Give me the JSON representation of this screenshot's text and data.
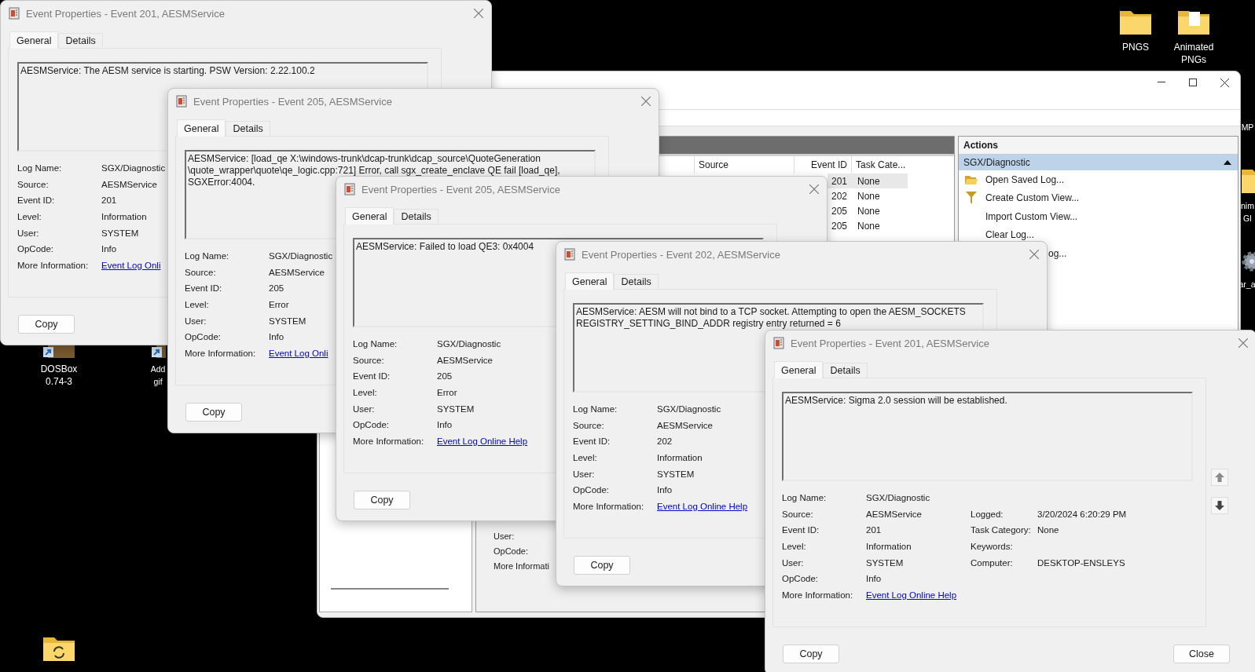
{
  "desktop_icons": [
    {
      "label": "PNGS",
      "kind": "folder"
    },
    {
      "label": "Animated\nPNGs",
      "kind": "docfolder"
    },
    {
      "label": "MP",
      "kind": "none"
    },
    {
      "label": "nim\nGI",
      "kind": "folder"
    },
    {
      "label": "ar_a",
      "kind": "gear"
    },
    {
      "label": "DOSBox\n0.74-3",
      "kind": "app"
    },
    {
      "label": "Add\ngif",
      "kind": "app"
    },
    {
      "kind": "syncfolder"
    }
  ],
  "main_window": {
    "table": {
      "columns": [
        "Source",
        "Event ID",
        "Task Cate..."
      ],
      "rows": [
        {
          "event_id": "201",
          "task_category": "None",
          "selected": true
        },
        {
          "event_id": "202",
          "task_category": "None",
          "selected": false
        },
        {
          "event_id": "205",
          "task_category": "None",
          "selected": false
        },
        {
          "event_id": "205",
          "task_category": "None",
          "selected": false
        }
      ]
    },
    "detail_labels": [
      "User:",
      "OpCode:",
      "More Informati"
    ],
    "actions": {
      "title": "Actions",
      "group": {
        "label": "SGX/Diagnostic",
        "expanded": true
      },
      "items": [
        {
          "label": "Open Saved Log...",
          "kind": "open"
        },
        {
          "label": "Create Custom View...",
          "kind": "filter"
        },
        {
          "label": "Import Custom View...",
          "kind": "plain"
        },
        {
          "label": "Clear Log...",
          "kind": "plain"
        },
        {
          "label": "og...",
          "kind": "cut"
        }
      ]
    }
  },
  "dialogs": [
    {
      "title": "Event Properties - Event 201, AESMService",
      "tabs": [
        {
          "label": "General",
          "selected": true
        },
        {
          "label": "Details",
          "selected": false
        }
      ],
      "message": "AESMService: The AESM service is starting. PSW Version: 2.22.100.2",
      "fields": [
        {
          "label": "Log Name:",
          "value": "SGX/Diagnostic",
          "kind": "text"
        },
        {
          "label": "Source:",
          "value": "AESMService",
          "kind": "text"
        },
        {
          "label": "Event ID:",
          "value": "201",
          "kind": "text"
        },
        {
          "label": "Level:",
          "value": "Information",
          "kind": "text"
        },
        {
          "label": "User:",
          "value": "SYSTEM",
          "kind": "text"
        },
        {
          "label": "OpCode:",
          "value": "Info",
          "kind": "text"
        },
        {
          "label": "More Information:",
          "value": "Event Log Onli",
          "kind": "link"
        }
      ],
      "buttons": [
        {
          "label": "Copy",
          "kind": "left"
        }
      ]
    },
    {
      "title": "Event Properties - Event 205, AESMService",
      "tabs": [
        {
          "label": "General",
          "selected": true
        },
        {
          "label": "Details",
          "selected": false
        }
      ],
      "message": "AESMService: [load_qe X:\\windows-trunk\\dcap-trunk\\dcap_source\\QuoteGeneration\n\\quote_wrapper\\quote\\qe_logic.cpp:721] Error, call sgx_create_enclave QE fail [load_qe],\nSGXError:4004.",
      "fields": [
        {
          "label": "Log Name:",
          "value": "SGX/Diagnostic",
          "kind": "text"
        },
        {
          "label": "Source:",
          "value": "AESMService",
          "kind": "text"
        },
        {
          "label": "Event ID:",
          "value": "205",
          "kind": "text"
        },
        {
          "label": "Level:",
          "value": "Error",
          "kind": "text"
        },
        {
          "label": "User:",
          "value": "SYSTEM",
          "kind": "text"
        },
        {
          "label": "OpCode:",
          "value": "Info",
          "kind": "text"
        },
        {
          "label": "More Information:",
          "value": "Event Log Onli",
          "kind": "link"
        }
      ],
      "buttons": [
        {
          "label": "Copy",
          "kind": "left"
        }
      ]
    },
    {
      "title": "Event Properties - Event 205, AESMService",
      "tabs": [
        {
          "label": "General",
          "selected": true
        },
        {
          "label": "Details",
          "selected": false
        }
      ],
      "message": "AESMService: Failed to load QE3: 0x4004",
      "fields": [
        {
          "label": "Log Name:",
          "value": "SGX/Diagnostic",
          "kind": "text"
        },
        {
          "label": "Source:",
          "value": "AESMService",
          "kind": "text"
        },
        {
          "label": "Event ID:",
          "value": "205",
          "kind": "text"
        },
        {
          "label": "Level:",
          "value": "Error",
          "kind": "text"
        },
        {
          "label": "User:",
          "value": "SYSTEM",
          "kind": "text"
        },
        {
          "label": "OpCode:",
          "value": "Info",
          "kind": "text"
        },
        {
          "label": "More Information:",
          "value": "Event Log Online Help",
          "kind": "link"
        }
      ],
      "buttons": [
        {
          "label": "Copy",
          "kind": "left"
        }
      ]
    },
    {
      "title": "Event Properties - Event 202, AESMService",
      "tabs": [
        {
          "label": "General",
          "selected": true
        },
        {
          "label": "Details",
          "selected": false
        }
      ],
      "message": "AESMService: AESM will not bind to a TCP socket. Attempting to open the AESM_SOCKETS\nREGISTRY_SETTING_BIND_ADDR registry entry returned = 6",
      "fields": [
        {
          "label": "Log Name:",
          "value": "SGX/Diagnostic",
          "kind": "text"
        },
        {
          "label": "Source:",
          "value": "AESMService",
          "kind": "text"
        },
        {
          "label": "Event ID:",
          "value": "202",
          "kind": "text"
        },
        {
          "label": "Level:",
          "value": "Information",
          "kind": "text"
        },
        {
          "label": "User:",
          "value": "SYSTEM",
          "kind": "text"
        },
        {
          "label": "OpCode:",
          "value": "Info",
          "kind": "text"
        },
        {
          "label": "More Information:",
          "value": "Event Log Online Help",
          "kind": "link"
        }
      ],
      "buttons": [
        {
          "label": "Copy",
          "kind": "left"
        }
      ]
    },
    {
      "title": "Event Properties - Event 201, AESMService",
      "tabs": [
        {
          "label": "General",
          "selected": true
        },
        {
          "label": "Details",
          "selected": false
        }
      ],
      "message": "AESMService: Sigma 2.0 session will be established.",
      "fields": [
        {
          "label": "Log Name:",
          "value": "SGX/Diagnostic",
          "kind": "text"
        },
        {
          "label": "Source:",
          "value": "AESMService",
          "kind": "text"
        },
        {
          "label": "Event ID:",
          "value": "201",
          "kind": "text"
        },
        {
          "label": "Level:",
          "value": "Information",
          "kind": "text"
        },
        {
          "label": "User:",
          "value": "SYSTEM",
          "kind": "text"
        },
        {
          "label": "OpCode:",
          "value": "Info",
          "kind": "text"
        },
        {
          "label": "More Information:",
          "value": "Event Log Online Help",
          "kind": "link"
        }
      ],
      "side_fields": [
        {
          "label": "Logged:",
          "value": "3/20/2024 6:20:29 PM"
        },
        {
          "label": "Task Category:",
          "value": "None"
        },
        {
          "label": "Keywords:"
        },
        {
          "label": "Computer:",
          "value": "DESKTOP-ENSLEYS"
        }
      ],
      "nav_arrows": true,
      "buttons": [
        {
          "label": "Copy",
          "kind": "left"
        },
        {
          "label": "Close",
          "kind": "right"
        }
      ]
    }
  ]
}
